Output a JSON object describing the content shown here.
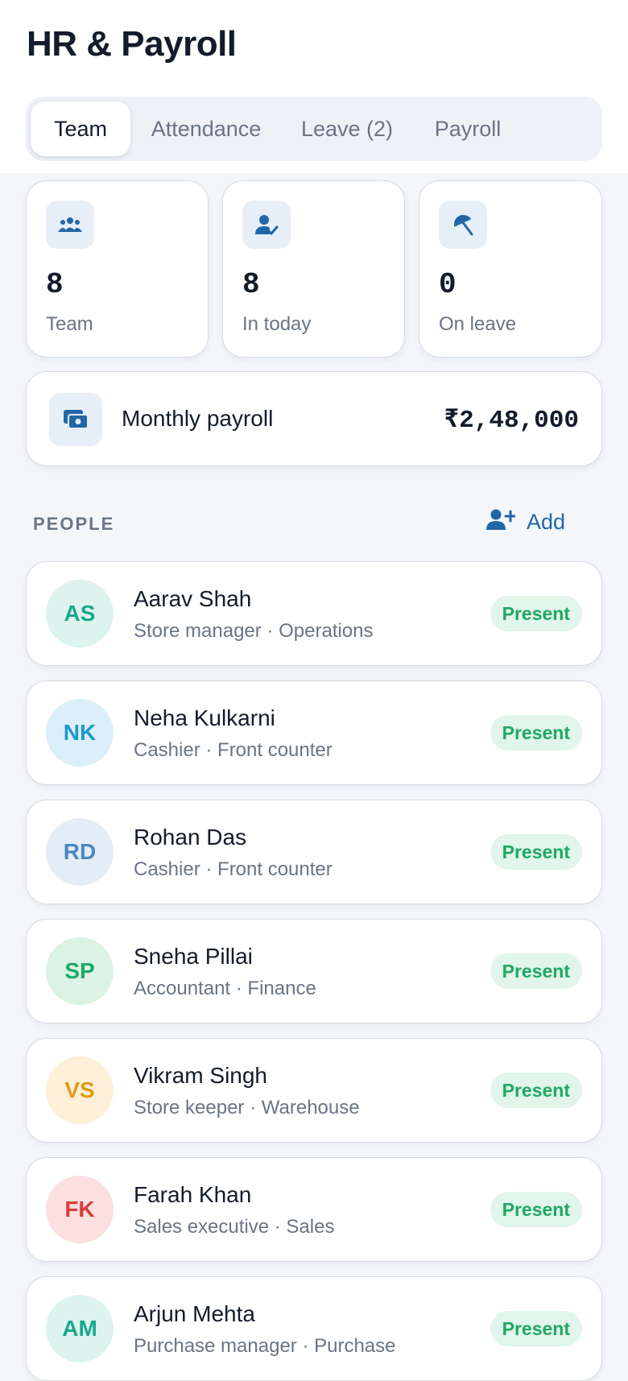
{
  "header": {
    "title": "HR & Payroll"
  },
  "tabs": [
    {
      "label": "Team",
      "active": true
    },
    {
      "label": "Attendance",
      "active": false
    },
    {
      "label": "Leave (2)",
      "active": false
    },
    {
      "label": "Payroll",
      "active": false
    }
  ],
  "stats": [
    {
      "icon": "team-icon",
      "value": "8",
      "label": "Team"
    },
    {
      "icon": "user-check-icon",
      "value": "8",
      "label": "In today"
    },
    {
      "icon": "umbrella-icon",
      "value": "0",
      "label": "On leave"
    }
  ],
  "payroll": {
    "icon": "money-icon",
    "label": "Monthly payroll",
    "value": "₹2,48,000"
  },
  "people_section": {
    "label": "PEOPLE",
    "add_label": "Add",
    "add_icon": "add-user-icon"
  },
  "people": [
    {
      "initials": "AS",
      "name": "Aarav Shah",
      "role": "Store manager · Operations",
      "status": "Present",
      "avatar_bg": "#dcf3ee",
      "avatar_fg": "#1aa88c"
    },
    {
      "initials": "NK",
      "name": "Neha Kulkarni",
      "role": "Cashier · Front counter",
      "status": "Present",
      "avatar_bg": "#dbeffa",
      "avatar_fg": "#1f97c9"
    },
    {
      "initials": "RD",
      "name": "Rohan Das",
      "role": "Cashier · Front counter",
      "status": "Present",
      "avatar_bg": "#e3edf8",
      "avatar_fg": "#4c86bf"
    },
    {
      "initials": "SP",
      "name": "Sneha Pillai",
      "role": "Accountant · Finance",
      "status": "Present",
      "avatar_bg": "#daf3e5",
      "avatar_fg": "#1fa865"
    },
    {
      "initials": "VS",
      "name": "Vikram Singh",
      "role": "Store keeper · Warehouse",
      "status": "Present",
      "avatar_bg": "#fdf0d8",
      "avatar_fg": "#e39a17"
    },
    {
      "initials": "FK",
      "name": "Farah Khan",
      "role": "Sales executive · Sales",
      "status": "Present",
      "avatar_bg": "#fcdfdf",
      "avatar_fg": "#d93c3c"
    },
    {
      "initials": "AM",
      "name": "Arjun Mehta",
      "role": "Purchase manager · Purchase",
      "status": "Present",
      "avatar_bg": "#dcf3ee",
      "avatar_fg": "#1aa88c"
    }
  ],
  "colors": {
    "accent": "#2166a6",
    "badge_bg": "#e1f5ea",
    "badge_fg": "#1fa865"
  }
}
